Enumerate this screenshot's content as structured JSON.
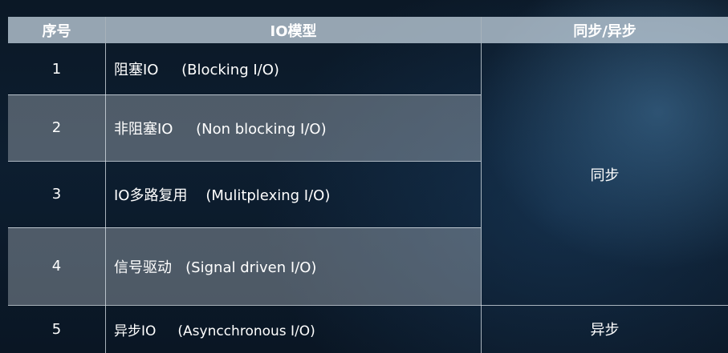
{
  "table": {
    "headers": {
      "index": "序号",
      "model": "IO模型",
      "sync": "同步/异步"
    },
    "rows": [
      {
        "index": "1",
        "model": "阻塞IO     (Blocking I/O)"
      },
      {
        "index": "2",
        "model": "非阻塞IO     (Non blocking I/O)"
      },
      {
        "index": "3",
        "model": "IO多路复用    (Mulitplexing I/O)"
      },
      {
        "index": "4",
        "model": "信号驱动   (Signal driven I/O)"
      },
      {
        "index": "5",
        "model": "异步IO     (Asyncchronous I/O)"
      }
    ],
    "sync_groups": [
      {
        "label": "同步",
        "rows": [
          1,
          2,
          3,
          4
        ]
      },
      {
        "label": "异步",
        "rows": [
          5
        ]
      }
    ]
  }
}
